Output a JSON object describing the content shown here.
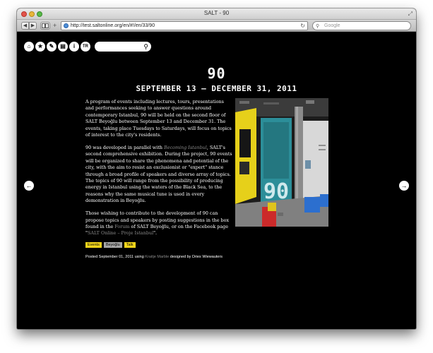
{
  "browser": {
    "window_title": "SALT - 90",
    "url": "http://test.saltonline.org/en/#!/en/33/90",
    "search_placeholder": "Google",
    "back_label": "◀",
    "forward_label": "▶",
    "plus_label": "+"
  },
  "site_nav": {
    "icons": [
      {
        "name": "home-icon",
        "glyph": "⌂"
      },
      {
        "name": "star-icon",
        "glyph": "★"
      },
      {
        "name": "tag-icon",
        "glyph": "✎"
      },
      {
        "name": "archive-icon",
        "glyph": "▤"
      },
      {
        "name": "info-icon",
        "glyph": "i"
      },
      {
        "name": "language-tr-icon",
        "glyph": "TR"
      }
    ],
    "search_value": ""
  },
  "post": {
    "title": "90",
    "subtitle": "SEPTEMBER 13 – DECEMBER 31, 2011",
    "p1": "A program of events including lectures, tours, presentations and performances seeking to answer questions around contemporary Istanbul, 90 will be held on the second floor of SALT Beyoğlu between September 13 and December 31. The events, taking place Tuesdays to Saturdays, will focus on topics of interest to the city's residents.",
    "p2_before": "90 was developed in parallel with ",
    "p2_link": "Becoming Istanbul",
    "p2_after": ", SALT's second comprehensive exhibition. During the project, 90 events will be organized to share the phenomena and potential of the city, with the aim to resist an exclusionist or \"expert\" stance through a broad profile of speakers and diverse array of topics. The topics of 90 will range from the possibility of producing energy in Istanbul using the waters of the Black Sea, to the reasons why the same musical tune is used in every demonstration in Beyoğlu.",
    "p3_before": "Those wishing to contribute to the development of 90 can propose topics and speakers by posting suggestions in the box found in the ",
    "p3_link1": "Forum",
    "p3_mid": " of SALT Beyoğlu, or on the Facebook page \"",
    "p3_link2": "SALT Online – Proje Istanbul",
    "p3_after": "\".",
    "tags": [
      "Events",
      "Beyoğlu",
      "Talk"
    ],
    "posted_before": "Posted September 01, 2011 using ",
    "posted_theme": "Kraitje Marble",
    "posted_after": " designed by Dries Wiewauters"
  },
  "colors": {
    "background": "#000000",
    "text": "#ffffff",
    "link": "#8a8a8a",
    "tag_yellow": "#f2d51b",
    "tag_gray": "#a7a7a7"
  }
}
